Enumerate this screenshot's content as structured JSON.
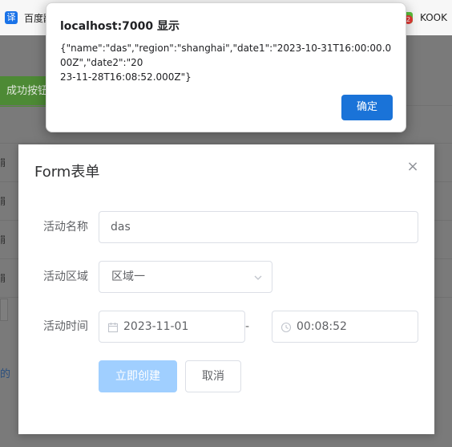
{
  "bookmarks": {
    "left_item": "百度翻",
    "right_item": "KOOK",
    "kook_badge": "2"
  },
  "background_page": {
    "success_button": "成功按钮",
    "row_texts": [
      "能",
      "能",
      "能",
      "能"
    ],
    "link_text": "的"
  },
  "dialog": {
    "title": "Form表单",
    "fields": {
      "name_label": "活动名称",
      "name_value": "das",
      "region_label": "活动区域",
      "region_value": "区域一",
      "time_label": "活动时间",
      "date_value": "2023-11-01",
      "range_separator": "-",
      "time_value": "00:08:52"
    },
    "buttons": {
      "create": "立即创建",
      "cancel": "取消"
    }
  },
  "alert": {
    "title": "localhost:7000 显示",
    "message": "{\"name\":\"das\",\"region\":\"shanghai\",\"date1\":\"2023-10-31T16:00:00.000Z\",\"date2\":\"20\n23-11-28T16:08:52.000Z\"}",
    "ok_label": "确定"
  },
  "colors": {
    "primary": "#409eff",
    "primary_disabled": "#a0cfff",
    "alert_button": "#1a73d8",
    "overlay": "#7a7a7a"
  }
}
